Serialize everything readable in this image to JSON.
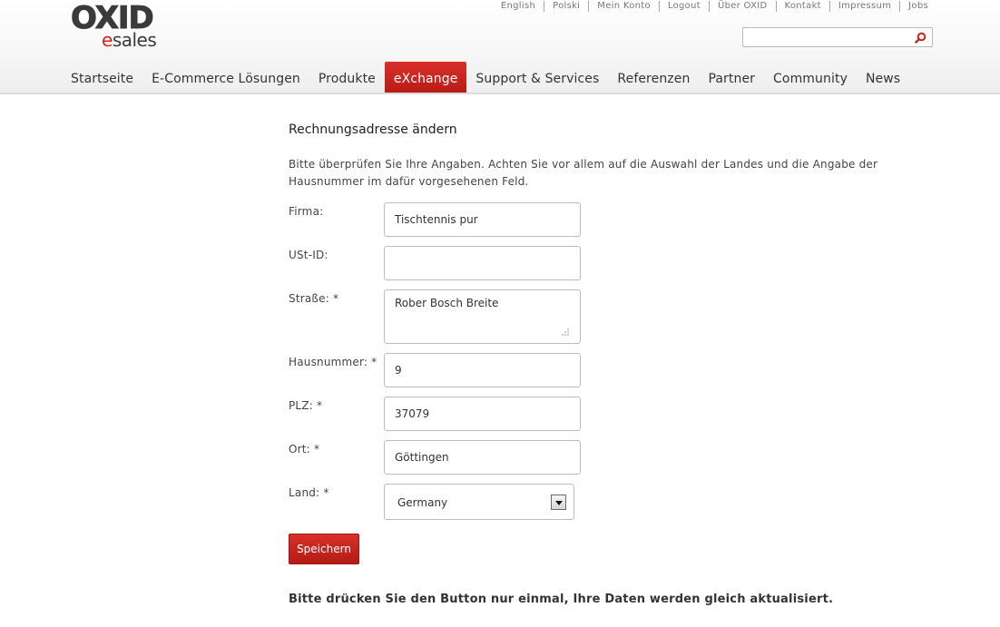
{
  "header": {
    "logo_main": "OXID",
    "logo_sub_e": "e",
    "logo_sub_rest": "sales",
    "toplinks": [
      "English",
      "Polski",
      "Mein Konto",
      "Logout",
      "Über OXID",
      "Kontakt",
      "Impressum",
      "Jobs"
    ],
    "search": {
      "value": "",
      "placeholder": ""
    },
    "nav": [
      "Startseite",
      "E-Commerce Lösungen",
      "Produkte",
      "eXchange",
      "Support & Services",
      "Referenzen",
      "Partner",
      "Community",
      "News"
    ],
    "active_nav": "eXchange"
  },
  "main": {
    "title": "Rechnungsadresse ändern",
    "intro": "Bitte überprüfen Sie Ihre Angaben. Achten Sie vor allem auf die Auswahl der Landes und die Angabe der Hausnummer im dafür vorgesehenen Feld.",
    "fields": {
      "firma": {
        "label": "Firma:",
        "value": "Tischtennis pur"
      },
      "ustid": {
        "label": "USt-ID:",
        "value": ""
      },
      "strasse": {
        "label": "Straße: *",
        "value": "Rober Bosch Breite"
      },
      "hausnummer": {
        "label": "Hausnummer: *",
        "value": "9"
      },
      "plz": {
        "label": "PLZ: *",
        "value": "37079"
      },
      "ort": {
        "label": "Ort: *",
        "value": "Göttingen"
      },
      "land": {
        "label": "Land: *",
        "value": "Germany"
      }
    },
    "save_label": "Speichern",
    "note": "Bitte drücken Sie den Button nur einmal, Ihre Daten werden gleich aktualisiert."
  },
  "colors": {
    "accent": "#c7231d",
    "text": "#333333",
    "border": "#bcbcbc"
  }
}
